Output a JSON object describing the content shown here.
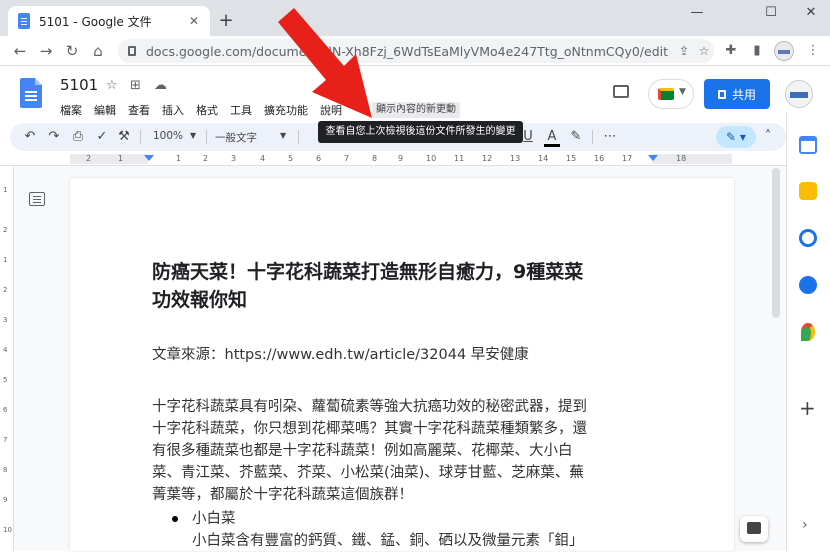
{
  "browser": {
    "tab": {
      "title": "5101 - Google 文件"
    },
    "new_tab_label": "+",
    "window_controls": {
      "minimize": "—",
      "maximize": "☐",
      "close": "✕"
    },
    "url": "docs.google.com/documen               wlN-Xh8Fzj_6WdTsEaMlyVMo4e247Ttg_oNtnmCQy0/edit"
  },
  "docs_header": {
    "doc_title": "5101",
    "menu": [
      "檔案",
      "編輯",
      "查看",
      "插入",
      "格式",
      "工具",
      "擴充功能",
      "說明"
    ],
    "last_edit_hint": "顯示內容的新更動",
    "share_label": "共用"
  },
  "toolbar": {
    "zoom": "100%",
    "style": "一般文字",
    "tooltip": "查看自您上次檢視後這份文件所發生的變更",
    "text_color_label": "A",
    "underline_label": "U"
  },
  "ruler": {
    "numbers": [
      "2",
      "1",
      "1",
      "2",
      "3",
      "4",
      "5",
      "6",
      "7",
      "8",
      "9",
      "10",
      "11",
      "12",
      "13",
      "14",
      "15",
      "16",
      "17",
      "18"
    ]
  },
  "document": {
    "heading_line1": "防癌天菜！十字花科蔬菜打造無形自癒力，9種菜菜",
    "heading_line2": "功效報你知",
    "source": "文章來源：https://www.edh.tw/article/32044  早安健康",
    "para_lines": [
      "十字花科蔬菜具有吲朶、蘿蔔硫素等強大抗癌功效的秘密武器，提到",
      "十字花科蔬菜，你只想到花椰菜嗎？其實十字花科蔬菜種類繁多，還",
      "有很多種蔬菜也都是十字花科蔬菜！例如高麗菜、花椰菜、大小白",
      "菜、青江菜、芥藍菜、芥菜、小松菜(油菜)、球芽甘藍、芝麻葉、蕪",
      "菁葉等，都屬於十字花科蔬菜這個族群！"
    ],
    "bullet_title": "小白菜",
    "bullet_text": "小白菜含有豐富的鈣質、鐵、錳、銅、硒以及微量元素「鉬」"
  },
  "colors": {
    "accent": "#1a73e8",
    "arrow": "#e8201a",
    "toolbar_bg": "#edf2fa"
  }
}
